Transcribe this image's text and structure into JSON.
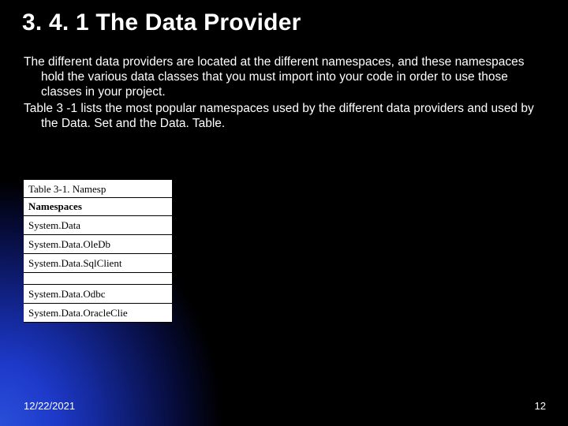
{
  "title": "3. 4. 1  The Data Provider",
  "paragraphs": [
    "The different data providers are located at the different namespaces, and these namespaces hold the various data classes that you must import into your code in order to use those classes in your project.",
    "Table 3 -1 lists the most popular namespaces used by the different data providers and used by the Data. Set and the Data. Table."
  ],
  "table": {
    "caption": "Table 3-1. Namesp",
    "header": "Namespaces",
    "rows": [
      "System.Data",
      "System.Data.OleDb",
      "System.Data.SqlClient",
      "",
      "System.Data.Odbc",
      "System.Data.OracleClie"
    ]
  },
  "footer": {
    "date": "12/22/2021",
    "page": "12"
  }
}
